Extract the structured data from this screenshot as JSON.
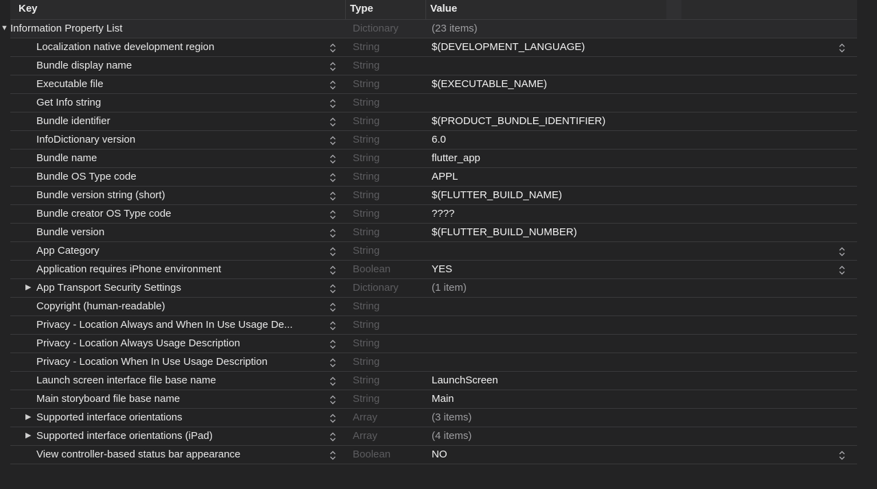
{
  "header": {
    "key": "Key",
    "type": "Type",
    "value": "Value"
  },
  "root": {
    "key": "Information Property List",
    "type": "Dictionary",
    "value": "(23 items)",
    "value_dim": true
  },
  "rows": [
    {
      "key": "Localization native development region",
      "type": "String",
      "value": "$(DEVELOPMENT_LANGUAGE)",
      "value_stepper": true
    },
    {
      "key": "Bundle display name",
      "type": "String",
      "value": ""
    },
    {
      "key": "Executable file",
      "type": "String",
      "value": "$(EXECUTABLE_NAME)"
    },
    {
      "key": "Get Info string",
      "type": "String",
      "value": ""
    },
    {
      "key": "Bundle identifier",
      "type": "String",
      "value": "$(PRODUCT_BUNDLE_IDENTIFIER)"
    },
    {
      "key": "InfoDictionary version",
      "type": "String",
      "value": "6.0"
    },
    {
      "key": "Bundle name",
      "type": "String",
      "value": "flutter_app"
    },
    {
      "key": "Bundle OS Type code",
      "type": "String",
      "value": "APPL"
    },
    {
      "key": "Bundle version string (short)",
      "type": "String",
      "value": "$(FLUTTER_BUILD_NAME)"
    },
    {
      "key": "Bundle creator OS Type code",
      "type": "String",
      "value": "????"
    },
    {
      "key": "Bundle version",
      "type": "String",
      "value": "$(FLUTTER_BUILD_NUMBER)"
    },
    {
      "key": "App Category",
      "type": "String",
      "value": "",
      "value_stepper": true
    },
    {
      "key": "Application requires iPhone environment",
      "type": "Boolean",
      "value": "YES",
      "value_stepper": true
    },
    {
      "key": "App Transport Security Settings",
      "type": "Dictionary",
      "value": "(1 item)",
      "expandable": true,
      "value_dim": true
    },
    {
      "key": "Copyright (human-readable)",
      "type": "String",
      "value": ""
    },
    {
      "key": "Privacy - Location Always and When In Use Usage De...",
      "type": "String",
      "value": ""
    },
    {
      "key": "Privacy - Location Always Usage Description",
      "type": "String",
      "value": ""
    },
    {
      "key": "Privacy - Location When In Use Usage Description",
      "type": "String",
      "value": ""
    },
    {
      "key": "Launch screen interface file base name",
      "type": "String",
      "value": "LaunchScreen"
    },
    {
      "key": "Main storyboard file base name",
      "type": "String",
      "value": "Main"
    },
    {
      "key": "Supported interface orientations",
      "type": "Array",
      "value": "(3 items)",
      "expandable": true,
      "value_dim": true
    },
    {
      "key": "Supported interface orientations (iPad)",
      "type": "Array",
      "value": "(4 items)",
      "expandable": true,
      "value_dim": true
    },
    {
      "key": "View controller-based status bar appearance",
      "type": "Boolean",
      "value": "NO",
      "value_stepper": true
    }
  ],
  "icons": {
    "collapse": "disclosure-down-icon",
    "expand": "disclosure-right-icon",
    "stepper": "up-down-stepper-icon"
  }
}
